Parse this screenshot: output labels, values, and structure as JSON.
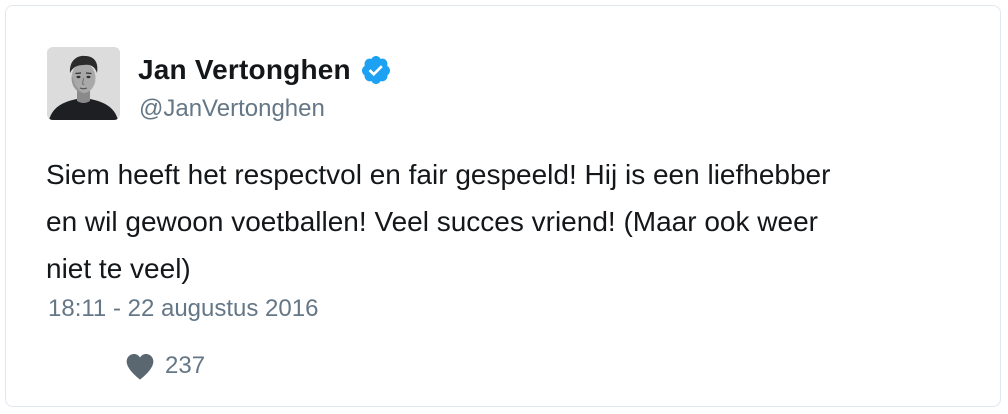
{
  "tweet": {
    "author": {
      "display_name": "Jan Vertonghen",
      "handle": "@JanVertonghen",
      "verified": true,
      "avatar_icon": "profile-photo"
    },
    "text_lines": [
      "Siem heeft het respectvol en fair gespeeld! Hij is een liefhebber",
      "en wil gewoon voetballen! Veel succes vriend! (Maar ook weer",
      "niet te veel)"
    ],
    "timestamp": "18:11 - 22 augustus 2016",
    "likes": {
      "icon": "heart-icon",
      "count": "237"
    }
  },
  "colors": {
    "verified_blue": "#1da1f2",
    "muted_text": "#657786",
    "heart_gray": "#5a6670",
    "border": "#e1e8ed"
  }
}
